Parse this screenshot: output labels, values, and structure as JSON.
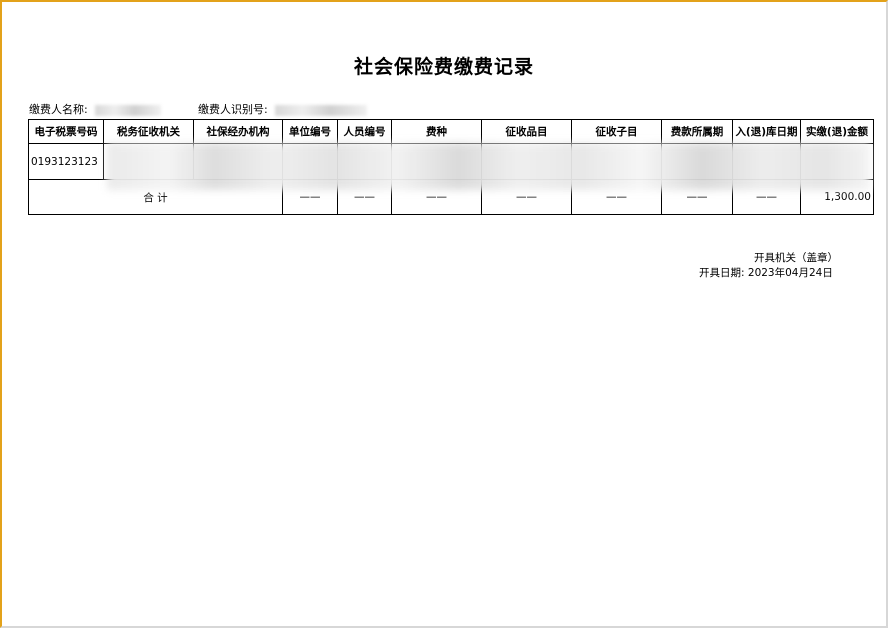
{
  "title": "社会保险费缴费记录",
  "payer": {
    "name_label": "缴费人名称:",
    "name_value": "",
    "id_label": "缴费人识别号:",
    "id_value": ""
  },
  "table": {
    "headers": [
      "电子税票号码",
      "税务征收机关",
      "社保经办机构",
      "单位编号",
      "人员编号",
      "费种",
      "征收品目",
      "征收子目",
      "费款所属期",
      "入(退)库日期",
      "实缴(退)金额"
    ],
    "rows": [
      {
        "ticket_no": "0193123123",
        "cells": [
          "",
          "",
          "",
          "",
          "",
          "",
          "",
          "",
          "",
          ""
        ]
      }
    ],
    "total": {
      "label": "合 计",
      "dashes": [
        "——",
        "——",
        "——",
        "——",
        "——",
        "——",
        "——"
      ],
      "amount": "1,300.00"
    }
  },
  "footer": {
    "issuer": "开具机关（盖章）",
    "date_label": "开具日期:",
    "date_value": "2023年04月24日"
  },
  "colors": {
    "frame_accent": "#e3a21a"
  }
}
